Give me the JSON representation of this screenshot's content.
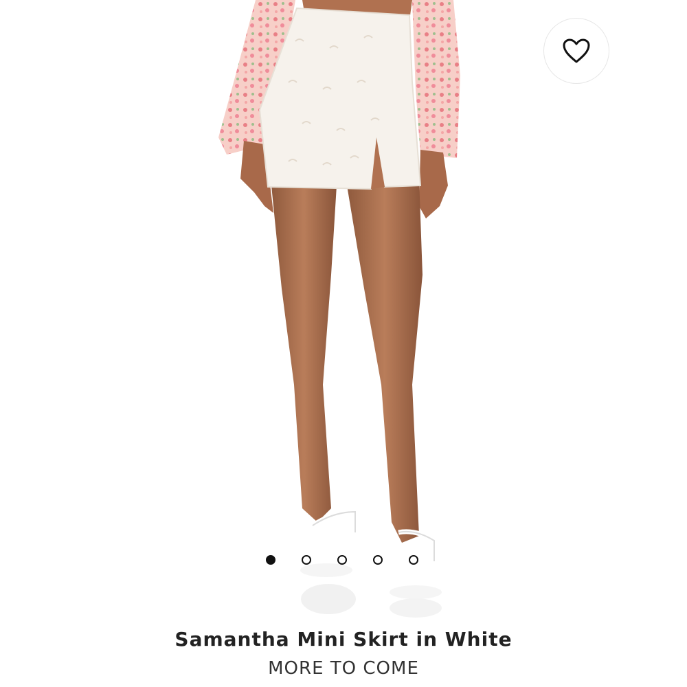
{
  "product": {
    "title": "Samantha Mini Skirt in White",
    "status": "MORE TO COME"
  },
  "favorite": {
    "icon": "heart-outline-icon"
  },
  "carousel": {
    "total": 5,
    "active_index": 0
  },
  "colors": {
    "text_primary": "#222222",
    "dot": "#111111",
    "skirt": "#f6f2ec",
    "skin": "#b07150",
    "blouse": "#f4b8b4"
  }
}
